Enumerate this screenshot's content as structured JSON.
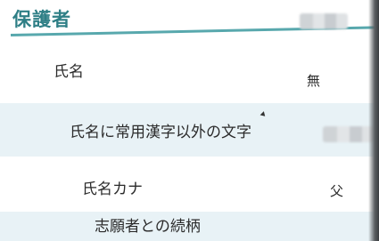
{
  "section": {
    "title": "保護者"
  },
  "rows": [
    {
      "label": "氏名",
      "value": ""
    },
    {
      "label": "氏名に常用漢字以外の文字",
      "value": "無"
    },
    {
      "label": "氏名カナ",
      "value": ""
    },
    {
      "label": "志願者との続柄",
      "value": "父"
    }
  ],
  "colors": {
    "accent": "#2f7f86",
    "underline": "#58a8ad",
    "row_tint": "#e8f2f6"
  }
}
